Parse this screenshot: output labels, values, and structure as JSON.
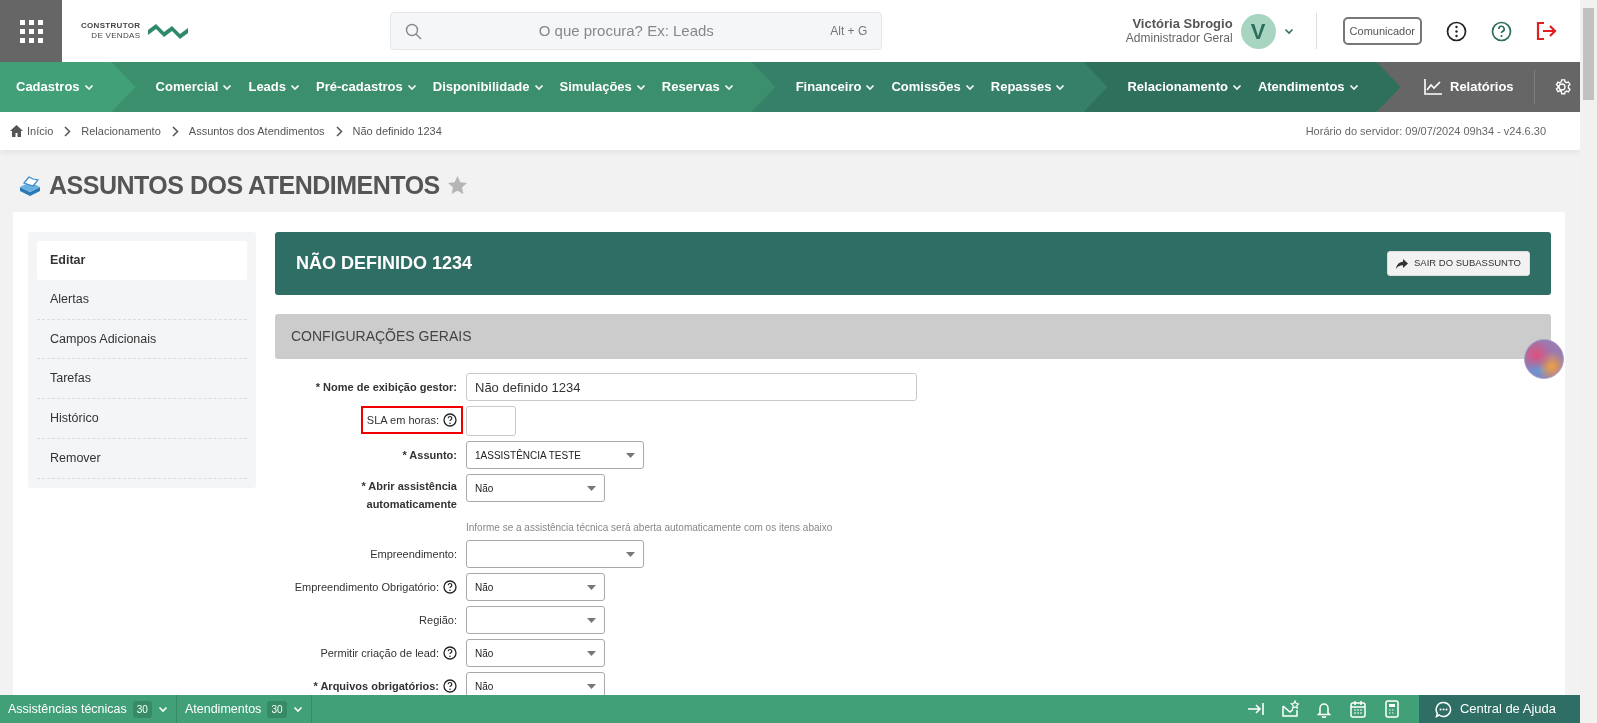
{
  "header": {
    "logo_lines": [
      "CONSTRUTOR",
      "DE VENDAS"
    ],
    "search": {
      "placeholder": "O que procura? Ex: Leads",
      "shortcut": "Alt + G"
    },
    "user": {
      "name": "Victória Sbrogio",
      "role": "Administrador Geral",
      "initial": "V"
    },
    "communicator_button": "Comunicador"
  },
  "nav": {
    "groups": [
      {
        "color": "#41a078",
        "items": [
          "Cadastros"
        ]
      },
      {
        "color": "#3b8f6d",
        "items": [
          "Comercial",
          "Leads",
          "Pré-cadastros",
          "Disponibilidade",
          "Simulações",
          "Reservas"
        ]
      },
      {
        "color": "#367f68",
        "items": [
          "Financeiro",
          "Comissões",
          "Repasses"
        ]
      },
      {
        "color": "#2f705c",
        "items": [
          "Relacionamento",
          "Atendimentos"
        ]
      }
    ],
    "reports": "Relatórios"
  },
  "breadcrumb": [
    "Início",
    "Relacionamento",
    "Assuntos dos Atendimentos",
    "Não definido 1234"
  ],
  "server_time": "Horário do servidor: 09/07/2024 09h34 - v24.6.30",
  "page": {
    "title": "ASSUNTOS DOS ATENDIMENTOS",
    "favorite": false
  },
  "sidebar": {
    "items": [
      {
        "label": "Editar",
        "selected": true
      },
      {
        "label": "Alertas",
        "selected": false
      },
      {
        "label": "Campos Adicionais",
        "selected": false
      },
      {
        "label": "Tarefas",
        "selected": false
      },
      {
        "label": "Histórico",
        "selected": false
      },
      {
        "label": "Remover",
        "selected": false
      }
    ]
  },
  "panel": {
    "title": "NÃO DEFINIDO 1234",
    "exit_button": "SAIR DO SUBASSUNTO",
    "section": "CONFIGURAÇÕES GERAIS",
    "fields": [
      {
        "kind": "text",
        "label": "* Nome de exibição gestor:",
        "required": true,
        "help": false,
        "highlighted": false,
        "value": "Não definido 1234"
      },
      {
        "kind": "number",
        "label": "SLA em horas:",
        "required": false,
        "help": true,
        "highlighted": true
      },
      {
        "kind": "select_wide",
        "label": "* Assunto:",
        "required": true,
        "help": false,
        "highlighted": false,
        "value": "1ASSISTÊNCIA TESTE"
      },
      {
        "kind": "select",
        "label": "* Abrir assistência automaticamente",
        "required": true,
        "help": false,
        "highlighted": false,
        "value": "Não",
        "hint": "Informe se a assistência técnica será aberta automaticamente com os itens abaixo"
      },
      {
        "kind": "select_wide",
        "label": "Empreendimento:",
        "required": false,
        "help": false,
        "highlighted": false
      },
      {
        "kind": "select",
        "label": "Empreendimento Obrigatório:",
        "required": false,
        "help": true,
        "highlighted": false,
        "value": "Não"
      },
      {
        "kind": "select",
        "label": "Região:",
        "required": false,
        "help": false,
        "highlighted": false
      },
      {
        "kind": "select",
        "label": "Permitir criação de lead:",
        "required": false,
        "help": true,
        "highlighted": false,
        "value": "Não"
      },
      {
        "kind": "select",
        "label": "* Arquivos obrigatórios:",
        "required": true,
        "help": true,
        "highlighted": false,
        "value": "Não"
      }
    ]
  },
  "bottom_bar": {
    "tabs": [
      {
        "label": "Assistências técnicas",
        "count": "30"
      },
      {
        "label": "Atendimentos",
        "count": "30"
      }
    ],
    "help": "Central de Ajuda"
  }
}
